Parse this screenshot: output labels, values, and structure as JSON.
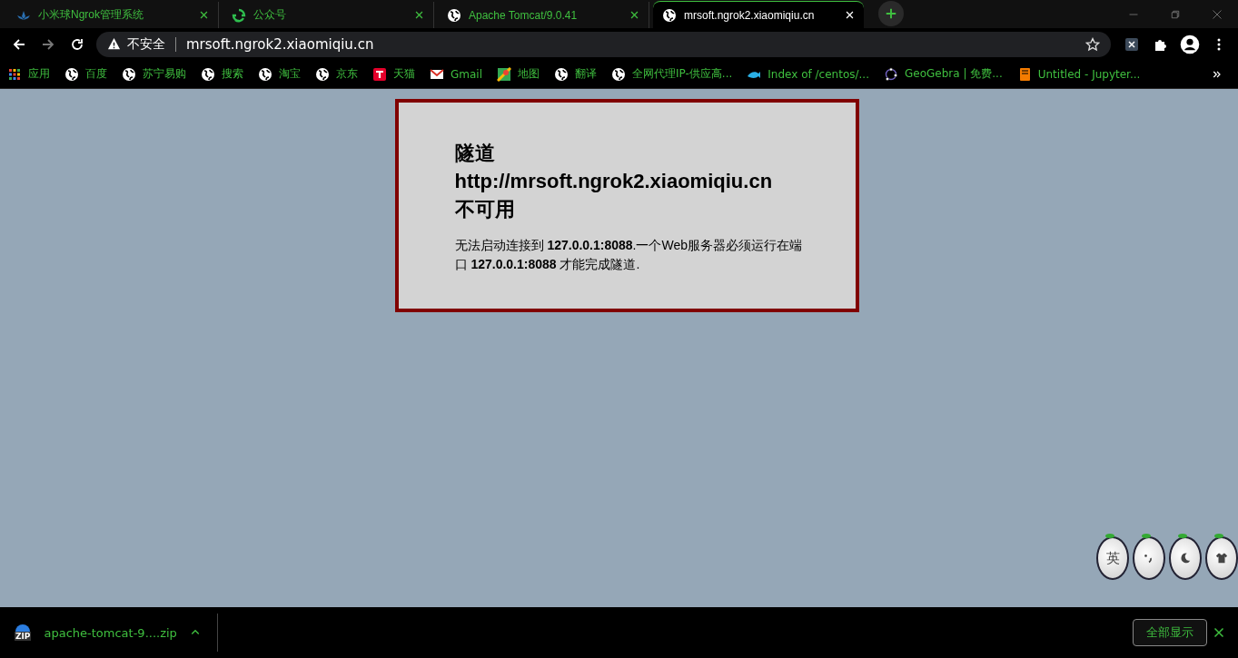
{
  "tabs": [
    {
      "title": "小米球Ngrok管理系统",
      "kind": "lotus",
      "selected": false
    },
    {
      "title": "公众号",
      "kind": "recycle",
      "selected": false
    },
    {
      "title": "Apache Tomcat/9.0.41",
      "kind": "globe",
      "selected": false
    },
    {
      "title": "mrsoft.ngrok2.xiaomiqiu.cn",
      "kind": "globe",
      "selected": true
    }
  ],
  "toolbar": {
    "security_label": "不安全",
    "url": "mrsoft.ngrok2.xiaomiqiu.cn"
  },
  "bookmarks": [
    {
      "label": "应用",
      "kind": "apps"
    },
    {
      "label": "百度",
      "kind": "globe"
    },
    {
      "label": "苏宁易购",
      "kind": "globe"
    },
    {
      "label": "搜索",
      "kind": "globe"
    },
    {
      "label": "淘宝",
      "kind": "globe"
    },
    {
      "label": "京东",
      "kind": "globe"
    },
    {
      "label": "天猫",
      "kind": "tmall"
    },
    {
      "label": "Gmail",
      "kind": "mail"
    },
    {
      "label": "地图",
      "kind": "map"
    },
    {
      "label": "翻译",
      "kind": "globe"
    },
    {
      "label": "全网代理IP-供应高...",
      "kind": "globe"
    },
    {
      "label": "Index of /centos/...",
      "kind": "fish"
    },
    {
      "label": "GeoGebra | 免费...",
      "kind": "ring"
    },
    {
      "label": "Untitled - Jupyter...",
      "kind": "book"
    }
  ],
  "error": {
    "title_lines": [
      "隧道",
      "http://mrsoft.ngrok2.xiaomiqiu.cn",
      "不可用"
    ],
    "message": "无法启动连接到 **127.0.0.1:8088**.一个Web服务器必须运行在端口 **127.0.0.1:8088** 才能完成隧道."
  },
  "ime_toolbar": {
    "mode_key": "英"
  },
  "download_bar": {
    "file_type": "ZIP",
    "file_name": "apache-tomcat-9....zip",
    "show_all": "全部显示"
  }
}
